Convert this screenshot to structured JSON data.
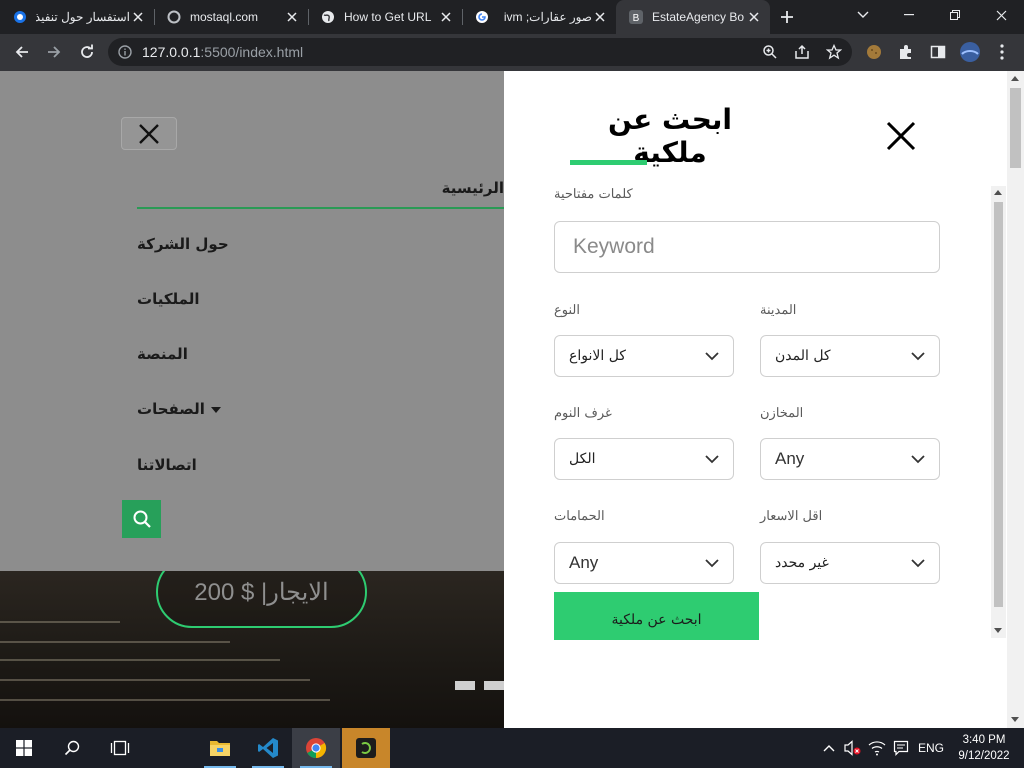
{
  "browser": {
    "tabs": [
      {
        "title": "استفسار حول تنفيذ",
        "icon": "blue-circle-icon",
        "active": false
      },
      {
        "title": "mostaql.com",
        "icon": "loading-icon",
        "active": false
      },
      {
        "title": "How to Get URL",
        "icon": "globe-icon",
        "active": false
      },
      {
        "title": "صور عقارات; ivm",
        "icon": "google-icon",
        "active": false
      },
      {
        "title": "EstateAgency Bo",
        "icon": "bootstrap-icon",
        "active": true
      }
    ],
    "url_host": "127.0.0.1",
    "url_rest": ":5500/index.html"
  },
  "nav": {
    "items": [
      {
        "label": "الرئيسية",
        "active": true
      },
      {
        "label": "حول الشركة"
      },
      {
        "label": "الملكيات"
      },
      {
        "label": "المنصة"
      },
      {
        "label": "الصفحات",
        "dropdown": true
      },
      {
        "label": "اتصالاتنا"
      }
    ]
  },
  "hero": {
    "price": "الايجار| $ 200"
  },
  "search": {
    "title": "ابحث عن ملكية",
    "keyword_label": "كلمات مفتاحية",
    "keyword_placeholder": "Keyword",
    "fields": {
      "city": {
        "label": "المدينة",
        "value": "كل المدن"
      },
      "type": {
        "label": "النوع",
        "value": "كل الانواع"
      },
      "garages": {
        "label": "المخازن",
        "value": "Any"
      },
      "bedrooms": {
        "label": "غرف النوم",
        "value": "الكل"
      },
      "min_price": {
        "label": "اقل الاسعار",
        "value": "غير محدد"
      },
      "bathrooms": {
        "label": "الحمامات",
        "value": "Any"
      }
    },
    "submit_label": "ابحث عن ملكية"
  },
  "colors": {
    "accent": "#2ecc71",
    "overlay": "#8d8d8d"
  },
  "taskbar": {
    "language": "ENG",
    "time": "3:40 PM",
    "date": "9/12/2022"
  }
}
